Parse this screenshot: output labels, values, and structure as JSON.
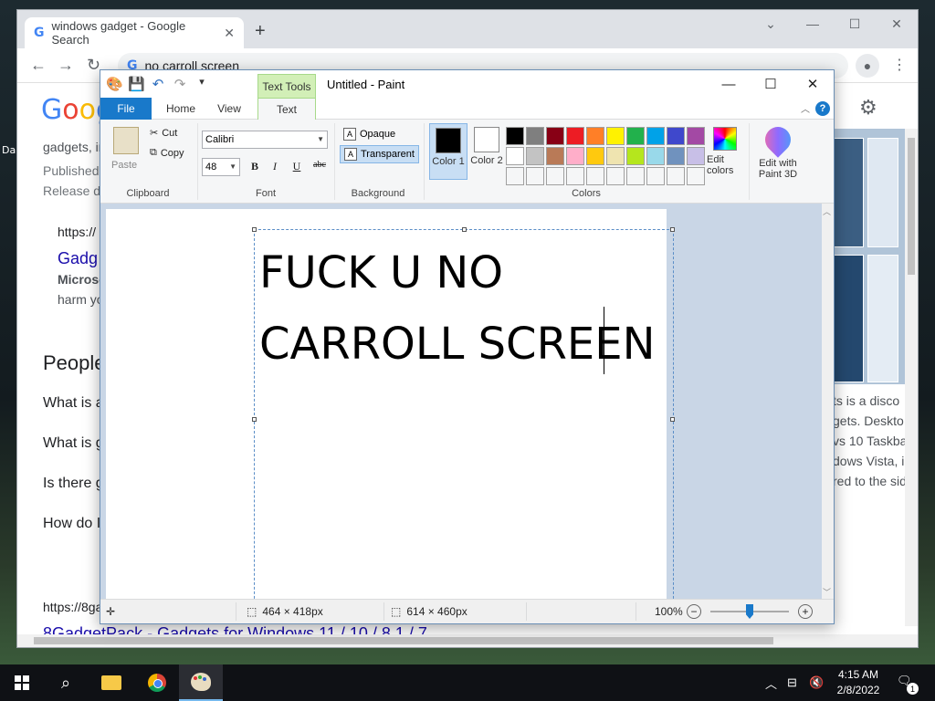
{
  "desktop": {
    "icon_label": "Da"
  },
  "browser": {
    "tab_title": "windows gadget - Google Search",
    "new_tab": "+",
    "omnibox_text": "no carroll screen",
    "serp": {
      "snippet_1": "gadgets, in",
      "published": "Published",
      "release": "Release da",
      "url_1": "https://",
      "result_title_1": "Gadg",
      "microsoft": "Microso",
      "harm": "harm yo",
      "people_heading": "People",
      "paa_1": "What is a",
      "paa_2": "What is g",
      "paa_3": "Is there g",
      "paa_4": "How do I",
      "url_2": "https://8ga",
      "result_title_2": "8GadgetPack - Gadgets for Windows 11 / 10 / 8.1 / 7",
      "right_1": "ts is a disco",
      "right_2": "gets. Deskto",
      "right_3": "vs 10 Taskba",
      "right_4": "dows Vista, i",
      "right_5": "red to the sid"
    }
  },
  "paint": {
    "context_tab": "Text Tools",
    "title": "Untitled - Paint",
    "tabs": {
      "file": "File",
      "home": "Home",
      "view": "View",
      "text": "Text"
    },
    "help": "?",
    "clipboard": {
      "paste": "Paste",
      "cut": "Cut",
      "copy": "Copy",
      "label": "Clipboard"
    },
    "font": {
      "family": "Calibri",
      "size": "48",
      "bold": "B",
      "italic": "I",
      "underline": "U",
      "strike": "abc",
      "label": "Font"
    },
    "background": {
      "opaque": "Opaque",
      "transparent": "Transparent",
      "label": "Background"
    },
    "colors": {
      "color1_label": "Color 1",
      "color2_label": "Color 2",
      "label": "Colors",
      "edit_colors": "Edit colors",
      "edit_3d": "Edit with Paint 3D",
      "color1": "#000000",
      "color2": "#ffffff",
      "palette": [
        "#000000",
        "#7f7f7f",
        "#880015",
        "#ed1c24",
        "#ff7f27",
        "#fff200",
        "#22b14c",
        "#00a2e8",
        "#3f48cc",
        "#a349a4",
        "#ffffff",
        "#c3c3c3",
        "#b97a57",
        "#ffaec9",
        "#ffc90e",
        "#efe4b0",
        "#b5e61d",
        "#99d9ea",
        "#7092be",
        "#c8bfe7",
        "#f5f6f7",
        "#f5f6f7",
        "#f5f6f7",
        "#f5f6f7",
        "#f5f6f7",
        "#f5f6f7",
        "#f5f6f7",
        "#f5f6f7",
        "#f5f6f7",
        "#f5f6f7"
      ]
    },
    "canvas": {
      "line_1": "FUCK U NO",
      "line_2": "CARROLL SCREEN"
    },
    "status": {
      "selection_size": "464 × 418px",
      "image_size": "614 × 460px",
      "zoom": "100%",
      "zoom_level": 0.5
    }
  },
  "taskbar": {
    "clock_time": "4:15 AM",
    "clock_date": "2/8/2022",
    "notifications": "1"
  }
}
